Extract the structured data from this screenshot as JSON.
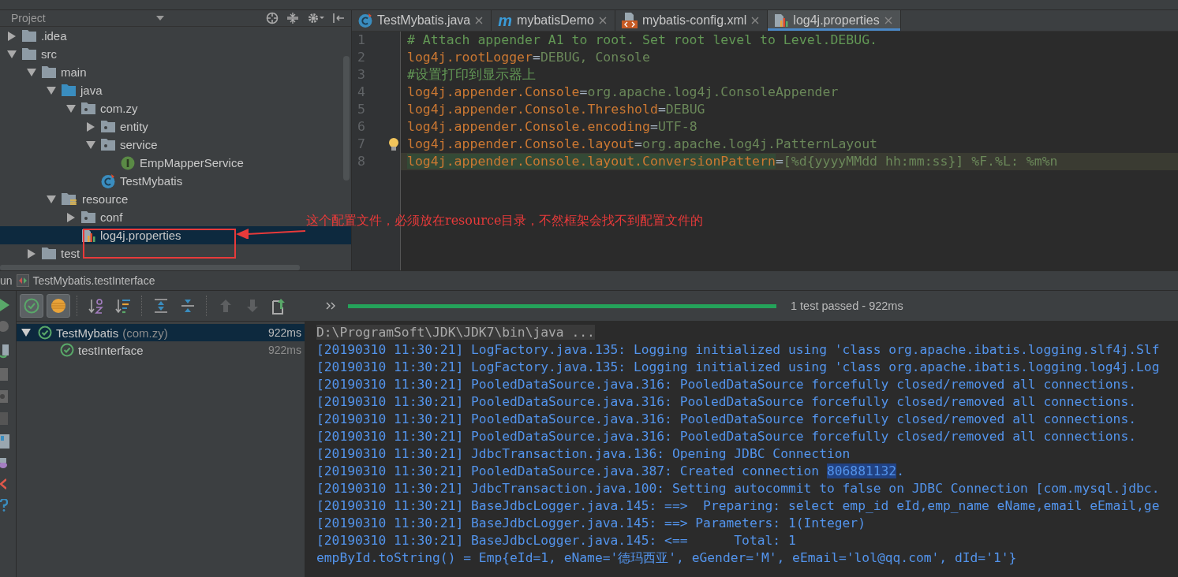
{
  "project": {
    "title": "Project",
    "tree": [
      {
        "label": ".idea",
        "kind": "folder",
        "expanded": false,
        "selected": false
      },
      {
        "label": "src",
        "kind": "folder",
        "expanded": true,
        "selected": false,
        "children": [
          {
            "label": "main",
            "kind": "folder",
            "expanded": true,
            "selected": false,
            "children": [
              {
                "label": "java",
                "kind": "source",
                "expanded": true,
                "selected": false,
                "children": [
                  {
                    "label": "com.zy",
                    "kind": "package",
                    "expanded": true,
                    "selected": false,
                    "children": [
                      {
                        "label": "entity",
                        "kind": "package",
                        "expanded": false,
                        "selected": false
                      },
                      {
                        "label": "service",
                        "kind": "package",
                        "expanded": true,
                        "selected": false,
                        "children": [
                          {
                            "label": "EmpMapperService",
                            "kind": "interface",
                            "selected": false
                          }
                        ]
                      },
                      {
                        "label": "TestMybatis",
                        "kind": "class",
                        "selected": false
                      }
                    ]
                  }
                ]
              },
              {
                "label": "resource",
                "kind": "resources",
                "expanded": true,
                "selected": false,
                "children": [
                  {
                    "label": "conf",
                    "kind": "package",
                    "expanded": false,
                    "selected": false
                  },
                  {
                    "label": "log4j.properties",
                    "kind": "properties",
                    "selected": true
                  }
                ]
              }
            ]
          },
          {
            "label": "test",
            "kind": "folder",
            "expanded": false,
            "selected": false
          }
        ]
      }
    ]
  },
  "tabs": [
    {
      "label": "TestMybatis.java",
      "kind": "class",
      "selected": false
    },
    {
      "label": "mybatisDemo",
      "kind": "maven",
      "glyph": "m",
      "selected": false
    },
    {
      "label": "mybatis-config.xml",
      "kind": "xml",
      "selected": false
    },
    {
      "label": "log4j.properties",
      "kind": "properties",
      "selected": true
    }
  ],
  "editor": {
    "lines": [
      {
        "number": "1",
        "kind": "comment",
        "text": "# Attach appender A1 to root. Set root level to Level.DEBUG.",
        "current": false
      },
      {
        "number": "2",
        "kind": "property",
        "key": "log4j.rootLogger",
        "sep": "=",
        "value": "DEBUG, Console",
        "current": false
      },
      {
        "number": "3",
        "kind": "comment",
        "text": "#设置打印到显示器上",
        "current": false
      },
      {
        "number": "4",
        "kind": "property",
        "key": "log4j.appender.Console",
        "sep": "=",
        "value": "org.apache.log4j.ConsoleAppender",
        "current": false
      },
      {
        "number": "5",
        "kind": "property",
        "key": "log4j.appender.Console.Threshold",
        "sep": "=",
        "value": "DEBUG",
        "current": false
      },
      {
        "number": "6",
        "kind": "property",
        "key": "log4j.appender.Console.encoding",
        "sep": "=",
        "value": "UTF-8",
        "current": false
      },
      {
        "number": "7",
        "kind": "property",
        "key": "log4j.appender.Console.layout",
        "sep": "=",
        "value": "org.apache.log4j.PatternLayout",
        "current": false,
        "bulb": true
      },
      {
        "number": "8",
        "kind": "property",
        "key": "log4j.appender.Console.layout.ConversionPattern",
        "sep": "=",
        "value": "[%d{yyyyMMdd hh:mm:ss}] %F.%L: %m%n",
        "current": true
      }
    ]
  },
  "annotation": {
    "text": "这个配置文件，必须放在resource目录，不然框架会找不到配置文件的"
  },
  "run": {
    "tool_label": "un",
    "config": "TestMybatis.testInterface",
    "toolbar": [
      {
        "kind": "show-passed",
        "on": true
      },
      {
        "kind": "show-ignored",
        "on": true
      },
      {
        "kind": "sort-alpha",
        "on": false
      },
      {
        "kind": "sort-duration",
        "on": false
      },
      {
        "kind": "expand-all",
        "on": false
      },
      {
        "kind": "collapse-all",
        "on": false
      },
      {
        "kind": "previous",
        "on": false
      },
      {
        "kind": "next",
        "on": false
      },
      {
        "kind": "export",
        "on": false
      }
    ],
    "progress": {
      "level": 1.0,
      "label": "1 test passed - 922ms"
    },
    "tests": [
      {
        "label": "TestMybatis",
        "detail": "(com.zy)",
        "time": "922ms",
        "passed": true,
        "expanded": true,
        "selected": true,
        "children": [
          {
            "label": "testInterface",
            "time": "922ms",
            "passed": true,
            "selected": false
          }
        ]
      }
    ],
    "console": [
      {
        "kind": "command",
        "text": "D:\\ProgramSoft\\JDK\\JDK7\\bin\\java ..."
      },
      {
        "kind": "log",
        "text": "[20190310 11:30:21] LogFactory.java.135: Logging initialized using 'class org.apache.ibatis.logging.slf4j.Slf"
      },
      {
        "kind": "log",
        "text": "[20190310 11:30:21] LogFactory.java.135: Logging initialized using 'class org.apache.ibatis.logging.log4j.Log"
      },
      {
        "kind": "log",
        "text": "[20190310 11:30:21] PooledDataSource.java.316: PooledDataSource forcefully closed/removed all connections."
      },
      {
        "kind": "log",
        "text": "[20190310 11:30:21] PooledDataSource.java.316: PooledDataSource forcefully closed/removed all connections."
      },
      {
        "kind": "log",
        "text": "[20190310 11:30:21] PooledDataSource.java.316: PooledDataSource forcefully closed/removed all connections."
      },
      {
        "kind": "log",
        "text": "[20190310 11:30:21] PooledDataSource.java.316: PooledDataSource forcefully closed/removed all connections."
      },
      {
        "kind": "log",
        "text": "[20190310 11:30:21] JdbcTransaction.java.136: Opening JDBC Connection"
      },
      {
        "kind": "log",
        "segments": [
          {
            "text": "[20190310 11:30:21] PooledDataSource.java.387: Created connection ",
            "selected": false
          },
          {
            "text": "806881132",
            "selected": true
          },
          {
            "text": ".",
            "selected": false
          }
        ]
      },
      {
        "kind": "log",
        "text": "[20190310 11:30:21] JdbcTransaction.java.100: Setting autocommit to false on JDBC Connection [com.mysql.jdbc."
      },
      {
        "kind": "log",
        "text": "[20190310 11:30:21] BaseJdbcLogger.java.145: ==>  Preparing: select emp_id eId,emp_name eName,email eEmail,ge"
      },
      {
        "kind": "log",
        "text": "[20190310 11:30:21] BaseJdbcLogger.java.145: ==> Parameters: 1(Integer)"
      },
      {
        "kind": "log",
        "text": "[20190310 11:30:21] BaseJdbcLogger.java.145: <==      Total: 1"
      },
      {
        "kind": "log",
        "text": "empById.toString() = Emp{eId=1, eName='德玛西亚', eGender='M', eEmail='lol@qq.com', dId='1'}"
      }
    ]
  }
}
